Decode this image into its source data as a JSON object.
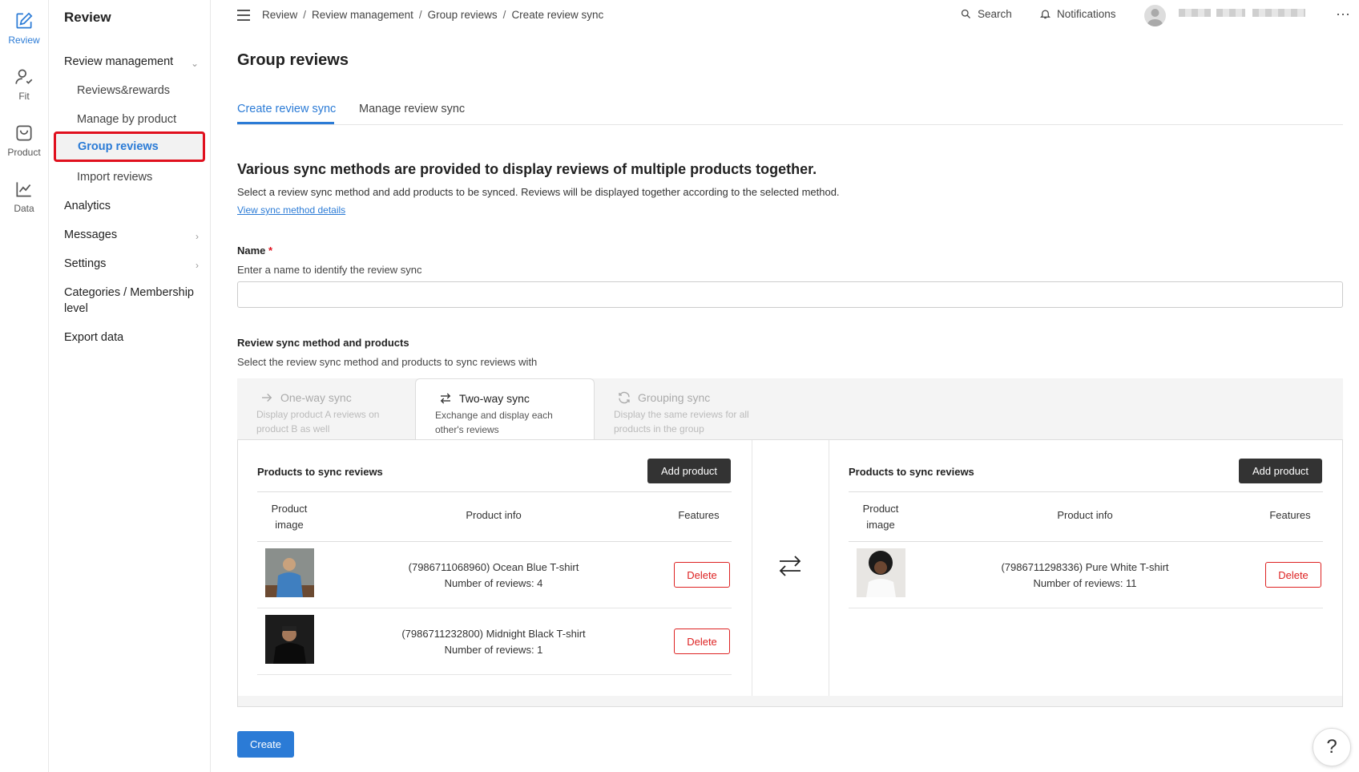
{
  "rail": {
    "items": [
      {
        "label": "Review",
        "icon": "edit-icon",
        "active": true
      },
      {
        "label": "Fit",
        "icon": "person-check-icon"
      },
      {
        "label": "Product",
        "icon": "bag-icon"
      },
      {
        "label": "Data",
        "icon": "chart-icon"
      }
    ]
  },
  "sidebar": {
    "title": "Review",
    "review_management": "Review management",
    "reviews_rewards": "Reviews&rewards",
    "manage_by_product": "Manage by product",
    "group_reviews": "Group reviews",
    "import_reviews": "Import reviews",
    "analytics": "Analytics",
    "messages": "Messages",
    "settings": "Settings",
    "categories": "Categories / Membership level",
    "export_data": "Export data"
  },
  "topbar": {
    "breadcrumbs": [
      "Review",
      "Review management",
      "Group reviews",
      "Create review sync"
    ],
    "search": "Search",
    "notifications": "Notifications"
  },
  "page": {
    "title": "Group reviews",
    "tabs": [
      "Create review sync",
      "Manage review sync"
    ],
    "heading": "Various sync methods are provided to display reviews of multiple products together.",
    "description": "Select a review sync method and add products to be synced. Reviews will be displayed together according to the selected method.",
    "details_link": "View sync method details",
    "name_label": "Name",
    "name_required": "*",
    "name_help": "Enter a name to identify the review sync",
    "name_value": "",
    "method_label": "Review sync method and products",
    "method_help": "Select the review sync method and products to sync reviews with",
    "create": "Create",
    "help": "?"
  },
  "methods": [
    {
      "title": "One-way sync",
      "desc": "Display product A reviews on product B as well",
      "state": "disabled"
    },
    {
      "title": "Two-way sync",
      "desc": "Exchange and display each other's reviews",
      "state": "active"
    },
    {
      "title": "Grouping sync",
      "desc": "Display the same reviews for all products in the group",
      "state": "disabled"
    }
  ],
  "panel": {
    "left": {
      "heading": "Products to sync reviews",
      "add": "Add product",
      "cols": [
        "Product image",
        "Product info",
        "Features"
      ],
      "rows": [
        {
          "name": "(7986711068960) Ocean Blue T-shirt",
          "reviews": "Number of reviews: 4",
          "action": "Delete"
        },
        {
          "name": "(7986711232800) Midnight Black T-shirt",
          "reviews": "Number of reviews: 1",
          "action": "Delete"
        }
      ]
    },
    "right": {
      "heading": "Products to sync reviews",
      "add": "Add product",
      "cols": [
        "Product image",
        "Product info",
        "Features"
      ],
      "rows": [
        {
          "name": "(7986711298336) Pure White T-shirt",
          "reviews": "Number of reviews: 11",
          "action": "Delete"
        }
      ]
    }
  },
  "colors": {
    "accent": "#2b7bd6",
    "danger": "#dd2222",
    "highlight": "#e0101e",
    "dark_button": "#333333"
  }
}
